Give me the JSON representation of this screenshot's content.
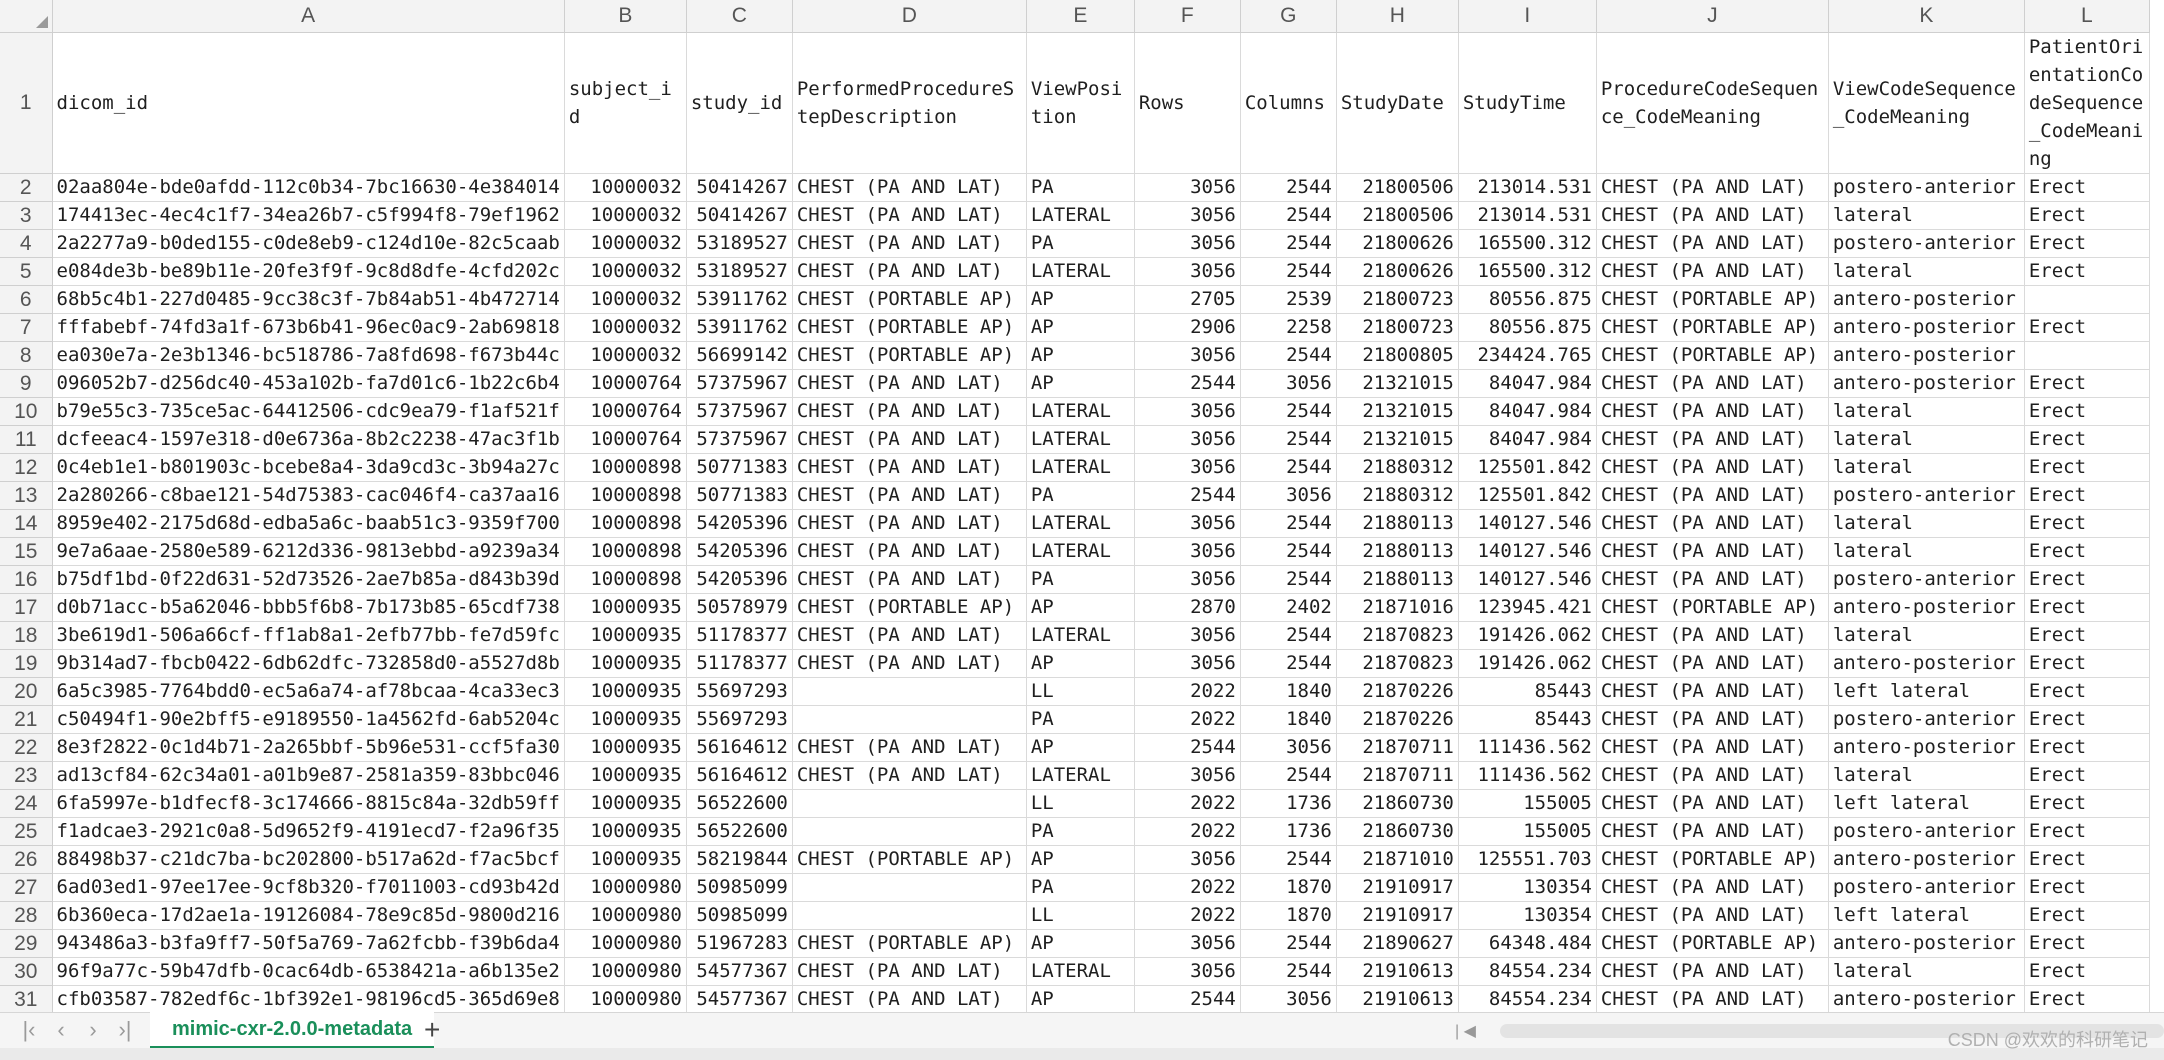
{
  "columns": [
    "A",
    "B",
    "C",
    "D",
    "E",
    "F",
    "G",
    "H",
    "I",
    "J",
    "K",
    "L"
  ],
  "headers": [
    "dicom_id",
    "subject_id",
    "study_id",
    "PerformedProcedureStepDescription",
    "ViewPosition",
    "Rows",
    "Columns",
    "StudyDate",
    "StudyTime",
    "ProcedureCodeSequence_CodeMeaning",
    "ViewCodeSequence_CodeMeaning",
    "PatientOrientationCodeSequence_CodeMeaning"
  ],
  "rows": [
    [
      "02aa804e-bde0afdd-112c0b34-7bc16630-4e384014",
      "10000032",
      "50414267",
      "CHEST (PA AND LAT)",
      "PA",
      "3056",
      "2544",
      "21800506",
      "213014.531",
      "CHEST (PA AND LAT)",
      "postero-anterior",
      "Erect"
    ],
    [
      "174413ec-4ec4c1f7-34ea26b7-c5f994f8-79ef1962",
      "10000032",
      "50414267",
      "CHEST (PA AND LAT)",
      "LATERAL",
      "3056",
      "2544",
      "21800506",
      "213014.531",
      "CHEST (PA AND LAT)",
      "lateral",
      "Erect"
    ],
    [
      "2a2277a9-b0ded155-c0de8eb9-c124d10e-82c5caab",
      "10000032",
      "53189527",
      "CHEST (PA AND LAT)",
      "PA",
      "3056",
      "2544",
      "21800626",
      "165500.312",
      "CHEST (PA AND LAT)",
      "postero-anterior",
      "Erect"
    ],
    [
      "e084de3b-be89b11e-20fe3f9f-9c8d8dfe-4cfd202c",
      "10000032",
      "53189527",
      "CHEST (PA AND LAT)",
      "LATERAL",
      "3056",
      "2544",
      "21800626",
      "165500.312",
      "CHEST (PA AND LAT)",
      "lateral",
      "Erect"
    ],
    [
      "68b5c4b1-227d0485-9cc38c3f-7b84ab51-4b472714",
      "10000032",
      "53911762",
      "CHEST (PORTABLE AP)",
      "AP",
      "2705",
      "2539",
      "21800723",
      "80556.875",
      "CHEST (PORTABLE AP)",
      "antero-posterior",
      ""
    ],
    [
      "fffabebf-74fd3a1f-673b6b41-96ec0ac9-2ab69818",
      "10000032",
      "53911762",
      "CHEST (PORTABLE AP)",
      "AP",
      "2906",
      "2258",
      "21800723",
      "80556.875",
      "CHEST (PORTABLE AP)",
      "antero-posterior",
      "Erect"
    ],
    [
      "ea030e7a-2e3b1346-bc518786-7a8fd698-f673b44c",
      "10000032",
      "56699142",
      "CHEST (PORTABLE AP)",
      "AP",
      "3056",
      "2544",
      "21800805",
      "234424.765",
      "CHEST (PORTABLE AP)",
      "antero-posterior",
      ""
    ],
    [
      "096052b7-d256dc40-453a102b-fa7d01c6-1b22c6b4",
      "10000764",
      "57375967",
      "CHEST (PA AND LAT)",
      "AP",
      "2544",
      "3056",
      "21321015",
      "84047.984",
      "CHEST (PA AND LAT)",
      "antero-posterior",
      "Erect"
    ],
    [
      "b79e55c3-735ce5ac-64412506-cdc9ea79-f1af521f",
      "10000764",
      "57375967",
      "CHEST (PA AND LAT)",
      "LATERAL",
      "3056",
      "2544",
      "21321015",
      "84047.984",
      "CHEST (PA AND LAT)",
      "lateral",
      "Erect"
    ],
    [
      "dcfeeac4-1597e318-d0e6736a-8b2c2238-47ac3f1b",
      "10000764",
      "57375967",
      "CHEST (PA AND LAT)",
      "LATERAL",
      "3056",
      "2544",
      "21321015",
      "84047.984",
      "CHEST (PA AND LAT)",
      "lateral",
      "Erect"
    ],
    [
      "0c4eb1e1-b801903c-bcebe8a4-3da9cd3c-3b94a27c",
      "10000898",
      "50771383",
      "CHEST (PA AND LAT)",
      "LATERAL",
      "3056",
      "2544",
      "21880312",
      "125501.842",
      "CHEST (PA AND LAT)",
      "lateral",
      "Erect"
    ],
    [
      "2a280266-c8bae121-54d75383-cac046f4-ca37aa16",
      "10000898",
      "50771383",
      "CHEST (PA AND LAT)",
      "PA",
      "2544",
      "3056",
      "21880312",
      "125501.842",
      "CHEST (PA AND LAT)",
      "postero-anterior",
      "Erect"
    ],
    [
      "8959e402-2175d68d-edba5a6c-baab51c3-9359f700",
      "10000898",
      "54205396",
      "CHEST (PA AND LAT)",
      "LATERAL",
      "3056",
      "2544",
      "21880113",
      "140127.546",
      "CHEST (PA AND LAT)",
      "lateral",
      "Erect"
    ],
    [
      "9e7a6aae-2580e589-6212d336-9813ebbd-a9239a34",
      "10000898",
      "54205396",
      "CHEST (PA AND LAT)",
      "LATERAL",
      "3056",
      "2544",
      "21880113",
      "140127.546",
      "CHEST (PA AND LAT)",
      "lateral",
      "Erect"
    ],
    [
      "b75df1bd-0f22d631-52d73526-2ae7b85a-d843b39d",
      "10000898",
      "54205396",
      "CHEST (PA AND LAT)",
      "PA",
      "3056",
      "2544",
      "21880113",
      "140127.546",
      "CHEST (PA AND LAT)",
      "postero-anterior",
      "Erect"
    ],
    [
      "d0b71acc-b5a62046-bbb5f6b8-7b173b85-65cdf738",
      "10000935",
      "50578979",
      "CHEST (PORTABLE AP)",
      "AP",
      "2870",
      "2402",
      "21871016",
      "123945.421",
      "CHEST (PORTABLE AP)",
      "antero-posterior",
      "Erect"
    ],
    [
      "3be619d1-506a66cf-ff1ab8a1-2efb77bb-fe7d59fc",
      "10000935",
      "51178377",
      "CHEST (PA AND LAT)",
      "LATERAL",
      "3056",
      "2544",
      "21870823",
      "191426.062",
      "CHEST (PA AND LAT)",
      "lateral",
      "Erect"
    ],
    [
      "9b314ad7-fbcb0422-6db62dfc-732858d0-a5527d8b",
      "10000935",
      "51178377",
      "CHEST (PA AND LAT)",
      "AP",
      "3056",
      "2544",
      "21870823",
      "191426.062",
      "CHEST (PA AND LAT)",
      "antero-posterior",
      "Erect"
    ],
    [
      "6a5c3985-7764bdd0-ec5a6a74-af78bcaa-4ca33ec3",
      "10000935",
      "55697293",
      "",
      "LL",
      "2022",
      "1840",
      "21870226",
      "85443",
      "CHEST (PA AND LAT)",
      "left lateral",
      "Erect"
    ],
    [
      "c50494f1-90e2bff5-e9189550-1a4562fd-6ab5204c",
      "10000935",
      "55697293",
      "",
      "PA",
      "2022",
      "1840",
      "21870226",
      "85443",
      "CHEST (PA AND LAT)",
      "postero-anterior",
      "Erect"
    ],
    [
      "8e3f2822-0c1d4b71-2a265bbf-5b96e531-ccf5fa30",
      "10000935",
      "56164612",
      "CHEST (PA AND LAT)",
      "AP",
      "2544",
      "3056",
      "21870711",
      "111436.562",
      "CHEST (PA AND LAT)",
      "antero-posterior",
      "Erect"
    ],
    [
      "ad13cf84-62c34a01-a01b9e87-2581a359-83bbc046",
      "10000935",
      "56164612",
      "CHEST (PA AND LAT)",
      "LATERAL",
      "3056",
      "2544",
      "21870711",
      "111436.562",
      "CHEST (PA AND LAT)",
      "lateral",
      "Erect"
    ],
    [
      "6fa5997e-b1dfecf8-3c174666-8815c84a-32db59ff",
      "10000935",
      "56522600",
      "",
      "LL",
      "2022",
      "1736",
      "21860730",
      "155005",
      "CHEST (PA AND LAT)",
      "left lateral",
      "Erect"
    ],
    [
      "f1adcae3-2921c0a8-5d9652f9-4191ecd7-f2a96f35",
      "10000935",
      "56522600",
      "",
      "PA",
      "2022",
      "1736",
      "21860730",
      "155005",
      "CHEST (PA AND LAT)",
      "postero-anterior",
      "Erect"
    ],
    [
      "88498b37-c21dc7ba-bc202800-b517a62d-f7ac5bcf",
      "10000935",
      "58219844",
      "CHEST (PORTABLE AP)",
      "AP",
      "3056",
      "2544",
      "21871010",
      "125551.703",
      "CHEST (PORTABLE AP)",
      "antero-posterior",
      "Erect"
    ],
    [
      "6ad03ed1-97ee17ee-9cf8b320-f7011003-cd93b42d",
      "10000980",
      "50985099",
      "",
      "PA",
      "2022",
      "1870",
      "21910917",
      "130354",
      "CHEST (PA AND LAT)",
      "postero-anterior",
      "Erect"
    ],
    [
      "6b360eca-17d2ae1a-19126084-78e9c85d-9800d216",
      "10000980",
      "50985099",
      "",
      "LL",
      "2022",
      "1870",
      "21910917",
      "130354",
      "CHEST (PA AND LAT)",
      "left lateral",
      "Erect"
    ],
    [
      "943486a3-b3fa9ff7-50f5a769-7a62fcbb-f39b6da4",
      "10000980",
      "51967283",
      "CHEST (PORTABLE AP)",
      "AP",
      "3056",
      "2544",
      "21890627",
      "64348.484",
      "CHEST (PORTABLE AP)",
      "antero-posterior",
      "Erect"
    ],
    [
      "96f9a77c-59b47dfb-0cac64db-6538421a-a6b135e2",
      "10000980",
      "54577367",
      "CHEST (PA AND LAT)",
      "LATERAL",
      "3056",
      "2544",
      "21910613",
      "84554.234",
      "CHEST (PA AND LAT)",
      "lateral",
      "Erect"
    ],
    [
      "cfb03587-782edf6c-1bf392e1-98196cd5-365d69e8",
      "10000980",
      "54577367",
      "CHEST (PA AND LAT)",
      "AP",
      "2544",
      "3056",
      "21910613",
      "84554.234",
      "CHEST (PA AND LAT)",
      "antero-posterior",
      "Erect"
    ]
  ],
  "sheet_tab": "mimic-cxr-2.0.0-metadata",
  "add_sheet_label": "+",
  "nav_icons": [
    "first-sheet-icon",
    "prev-sheet-icon",
    "next-sheet-icon",
    "last-sheet-icon"
  ],
  "watermark": "CSDN @欢欢的科研笔记",
  "colors": {
    "tab_accent": "#1a8f5a",
    "header_bg": "#f3f3f3",
    "grid_line": "#dadada"
  }
}
